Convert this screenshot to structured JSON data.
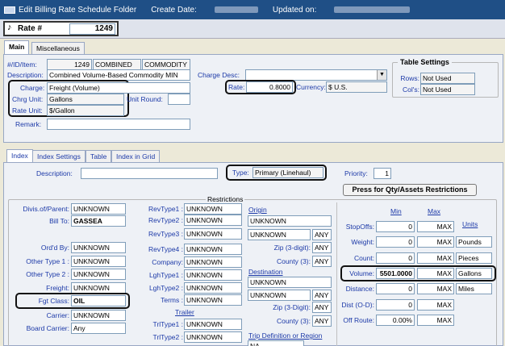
{
  "window": {
    "title": "Edit Billing Rate Schedule Folder",
    "create_date_label": "Create Date:",
    "updated_on_label": "Updated on:"
  },
  "rate": {
    "label": "Rate #",
    "value": "1249"
  },
  "tabs": {
    "main": "Main",
    "misc": "Miscellaneous"
  },
  "main": {
    "id_label": "#/ID/Item:",
    "id": "1249",
    "id_type": "COMBINED",
    "item": "COMMODITY",
    "description_label": "Description:",
    "description": "Combined Volume-Based Commodity MIN",
    "charge_label": "Charge:",
    "charge": "Freight (Volume)",
    "chrg_unit_label": "Chrg Unit:",
    "chrg_unit": "Gallons",
    "unit_round_label": "Unit Round:",
    "unit_round": "",
    "rate_unit_label": "Rate Unit:",
    "rate_unit": "$/Gallon",
    "remark_label": "Remark:",
    "remark": "",
    "charge_desc_label": "Charge Desc:",
    "charge_desc": "",
    "rate_label": "Rate:",
    "rate": "0.8000",
    "currency_label": "Currency:",
    "currency": "$ U.S."
  },
  "table_settings": {
    "title": "Table Settings",
    "rows_label": "Rows:",
    "rows": "Not Used",
    "cols_label": "Col's:",
    "cols": "Not Used"
  },
  "subtabs": {
    "index": "Index",
    "index_settings": "Index Settings",
    "table": "Table",
    "index_grid": "Index in Grid"
  },
  "index": {
    "description_label": "Description:",
    "description": "",
    "type_label": "Type:",
    "type": "Primary (Linehaul)",
    "priority_label": "Priority:",
    "priority": "1",
    "qty_button": "Press for Qty/Assets Restrictions",
    "restrictions_title": "Restrictions"
  },
  "left": {
    "divis_label": "Divis.of/Parent:",
    "divis": "UNKNOWN",
    "billto_label": "Bill To:",
    "billto": "GASSEA",
    "ordby_label": "Ord'd By:",
    "ordby": "UNKNOWN",
    "ot1_label": "Other Type 1 :",
    "ot1": "UNKNOWN",
    "ot2_label": "Other Type 2 :",
    "ot2": "UNKNOWN",
    "freight_label": "Freight:",
    "freight": "UNKNOWN",
    "fgt_label": "Fgt Class:",
    "fgt": "OIL",
    "carrier_label": "Carrier:",
    "carrier": "UNKNOWN",
    "board_label": "Board Carrier:",
    "board": "Any"
  },
  "mid": {
    "rev1_label": "RevType1 :",
    "rev1": "UNKNOWN",
    "rev2_label": "RevType2 :",
    "rev2": "UNKNOWN",
    "rev3_label": "RevType3 :",
    "rev3": "UNKNOWN",
    "rev4_label": "RevType4 :",
    "rev4": "UNKNOWN",
    "company_label": "Company:",
    "company": "UNKNOWN",
    "lgh1_label": "LghType1 :",
    "lgh1": "UNKNOWN",
    "lgh2_label": "LghType2 :",
    "lgh2": "UNKNOWN",
    "terms_label": "Terms :",
    "terms": "UNKNOWN",
    "trailer_label": "Trailer",
    "trl1_label": "TrlType1 :",
    "trl1": "UNKNOWN",
    "trl2_label": "TrlType2 :",
    "trl2": "UNKNOWN"
  },
  "origin": {
    "label": "Origin",
    "val1": "UNKNOWN",
    "val2": "UNKNOWN",
    "any1": "ANY",
    "zip_label": "Zip (3-digit):",
    "zip": "ANY",
    "county_label": "County (3):",
    "county": "ANY"
  },
  "destination": {
    "label": "Destination",
    "val1": "UNKNOWN",
    "val2": "UNKNOWN",
    "any1": "ANY",
    "zip_label": "Zip (3-Digit):",
    "zip": "ANY",
    "county_label": "County (3):",
    "county": "ANY"
  },
  "trip": {
    "label": "Trip Definition or Region",
    "value": "NA"
  },
  "minmax": {
    "min_label": "Min",
    "max_label": "Max",
    "units_label": "Units",
    "rows": [
      {
        "label": "StopOffs:",
        "min": "0",
        "max": "MAX",
        "unit": ""
      },
      {
        "label": "Weight:",
        "min": "0",
        "max": "MAX",
        "unit": "Pounds"
      },
      {
        "label": "Count:",
        "min": "0",
        "max": "MAX",
        "unit": "Pieces"
      },
      {
        "label": "Volume:",
        "min": "5501.0000",
        "max": "MAX",
        "unit": "Gallons"
      },
      {
        "label": "Distance:",
        "min": "0",
        "max": "MAX",
        "unit": "Miles"
      },
      {
        "label": "Dist (O-D):",
        "min": "0",
        "max": "MAX",
        "unit": ""
      },
      {
        "label": "Off Route:",
        "min": "0.00%",
        "max": "MAX",
        "unit": ""
      }
    ]
  }
}
